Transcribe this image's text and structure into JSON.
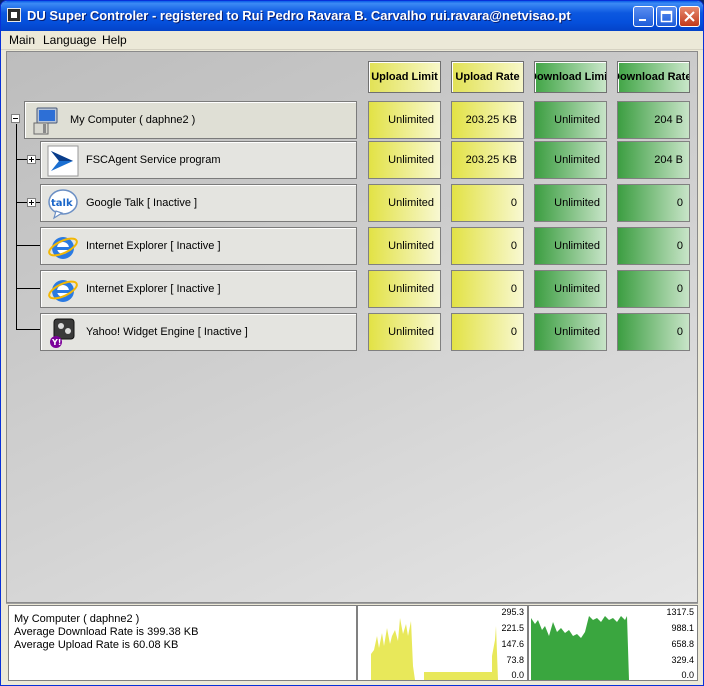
{
  "window": {
    "title": "DU Super Controler - registered to Rui Pedro Ravara B. Carvalho rui.ravara@netvisao.pt",
    "controls": [
      "minimize",
      "maximize",
      "close"
    ]
  },
  "menu": [
    "Main",
    "Language",
    "Help"
  ],
  "columns": [
    {
      "label": "Upload Limit",
      "color": "#e2e255"
    },
    {
      "label": "Upload Rate",
      "color": "#e2e255"
    },
    {
      "label": "Download Limit",
      "color": "#41a546"
    },
    {
      "label": "Download Rate",
      "color": "#41a546"
    }
  ],
  "processes": [
    {
      "name": "My Computer ( daphne2 )",
      "icon": "computer-icon",
      "upload_limit": "Unlimited",
      "upload_rate": "203.25 KB",
      "download_limit": "Unlimited",
      "download_rate": "204  B"
    },
    {
      "name": "FSCAgent Service program",
      "icon": "fscagent-icon",
      "upload_limit": "Unlimited",
      "upload_rate": "203.25 KB",
      "download_limit": "Unlimited",
      "download_rate": "204  B"
    },
    {
      "name": "Google Talk  [ Inactive ]",
      "icon": "google-talk-icon",
      "upload_limit": "Unlimited",
      "upload_rate": "0",
      "download_limit": "Unlimited",
      "download_rate": "0"
    },
    {
      "name": "Internet Explorer  [ Inactive ]",
      "icon": "internet-explorer-icon",
      "upload_limit": "Unlimited",
      "upload_rate": "0",
      "download_limit": "Unlimited",
      "download_rate": "0"
    },
    {
      "name": "Internet Explorer  [ Inactive ]",
      "icon": "internet-explorer-icon",
      "upload_limit": "Unlimited",
      "upload_rate": "0",
      "download_limit": "Unlimited",
      "download_rate": "0"
    },
    {
      "name": "Yahoo! Widget Engine  [ Inactive ]",
      "icon": "yahoo-widget-icon",
      "upload_limit": "Unlimited",
      "upload_rate": "0",
      "download_limit": "Unlimited",
      "download_rate": "0"
    }
  ],
  "status": {
    "selected": "My Computer ( daphne2 )",
    "avg_download": "Average Download Rate is 399.38 KB",
    "avg_upload": "Average Upload Rate is 60.08 KB"
  },
  "upload_graph": {
    "color": "#e8e85a",
    "scale": [
      "295.3",
      "221.5",
      "147.6",
      "73.8",
      "0.0"
    ]
  },
  "download_graph": {
    "color": "#3aa63f",
    "scale": [
      "1317.5",
      "988.1",
      "658.8",
      "329.4",
      "0.0"
    ]
  }
}
